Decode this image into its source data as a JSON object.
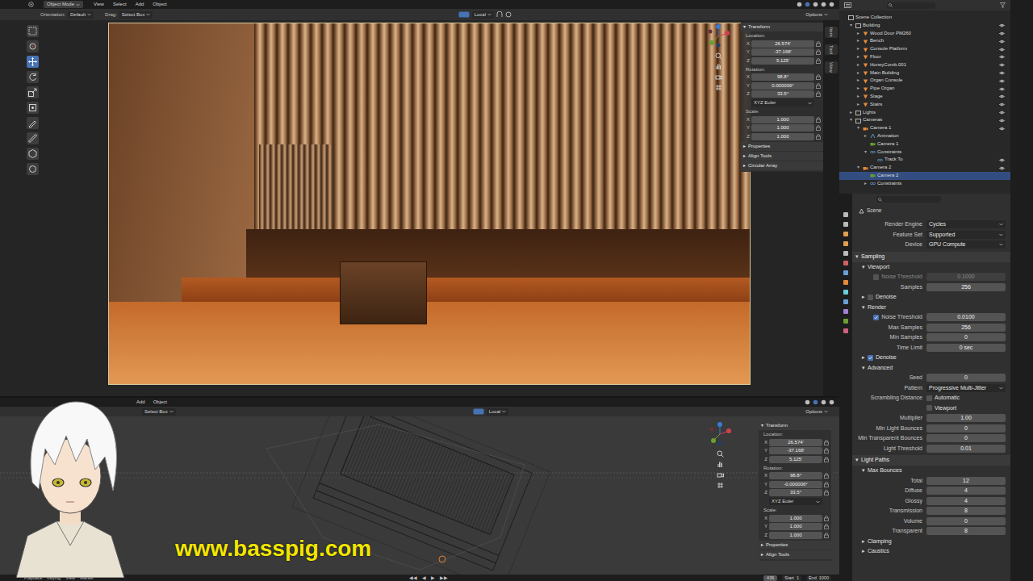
{
  "top_viewport": {
    "menu": [
      "Object Mode",
      "View",
      "Select",
      "Add",
      "Object"
    ],
    "header": [
      {
        "label": "Orientation:",
        "value": "Default"
      },
      {
        "label": "Drag:",
        "value": "Select Box"
      }
    ],
    "pivot": "Local",
    "options": "Options",
    "tools": [
      {
        "selected": false
      },
      {
        "selected": false
      },
      {
        "selected": true
      },
      {
        "selected": false
      },
      {
        "selected": false
      },
      {
        "selected": false
      },
      {
        "selected": false
      },
      {
        "selected": false
      },
      {
        "selected": false
      },
      {
        "selected": false
      }
    ],
    "side_tabs": [
      "Item",
      "Tool",
      "View"
    ],
    "transform": {
      "arrow": "▾",
      "title": "Transform",
      "groups": [
        {
          "label": "Location:",
          "fields": [
            {
              "axis": "X",
              "value": "26.574'"
            },
            {
              "axis": "Y",
              "value": "-37.168'"
            },
            {
              "axis": "Z",
              "value": "5.125'"
            }
          ]
        },
        {
          "label": "Rotation:",
          "fields": [
            {
              "axis": "X",
              "value": "98.8°"
            },
            {
              "axis": "Y",
              "value": "0.000006°"
            },
            {
              "axis": "Z",
              "value": "33.5°"
            }
          ],
          "mode": "XYZ Euler"
        },
        {
          "label": "Scale:",
          "fields": [
            {
              "axis": "X",
              "value": "1.000"
            },
            {
              "axis": "Y",
              "value": "1.000"
            },
            {
              "axis": "Z",
              "value": "1.000"
            }
          ]
        }
      ]
    },
    "panels": [
      {
        "arrow": "▸",
        "label": "Properties"
      },
      {
        "arrow": "▸",
        "label": "Align Tools"
      },
      {
        "arrow": "▸",
        "label": "Circular Array"
      }
    ]
  },
  "bottom_viewport": {
    "menu": [
      "Add",
      "Object"
    ],
    "drag": "Select Box",
    "pivot": "Local",
    "options": "Options",
    "transform": {
      "arrow": "▾",
      "title": "Transform",
      "groups": [
        {
          "label": "Location:",
          "fields": [
            {
              "axis": "X",
              "value": "26.574'"
            },
            {
              "axis": "Y",
              "value": "-37.168'"
            },
            {
              "axis": "Z",
              "value": "5.125'"
            }
          ]
        },
        {
          "label": "Rotation:",
          "fields": [
            {
              "axis": "X",
              "value": "98.8°"
            },
            {
              "axis": "Y",
              "value": "-0.000006°"
            },
            {
              "axis": "Z",
              "value": "33.5°"
            }
          ],
          "mode": "XYZ Euler"
        },
        {
          "label": "Scale:",
          "fields": [
            {
              "axis": "X",
              "value": "1.000"
            },
            {
              "axis": "Y",
              "value": "1.000"
            },
            {
              "axis": "Z",
              "value": "1.000"
            }
          ]
        }
      ]
    },
    "panels": [
      {
        "arrow": "▸",
        "label": "Properties"
      },
      {
        "arrow": "▸",
        "label": "Align Tools"
      }
    ]
  },
  "outliner": {
    "items": [
      {
        "label": "Scene Collection",
        "depth": 0,
        "arrow": "",
        "kind": "collection",
        "eye": false,
        "selected": false
      },
      {
        "label": "Building",
        "depth": 1,
        "arrow": "▾",
        "kind": "collection",
        "eye": true,
        "selected": false
      },
      {
        "label": "Wood Door PM260",
        "depth": 2,
        "arrow": "▸",
        "kind": "object",
        "eye": true,
        "selected": false
      },
      {
        "label": "Bench",
        "depth": 2,
        "arrow": "▸",
        "kind": "object",
        "eye": true,
        "selected": false
      },
      {
        "label": "Console Platform",
        "depth": 2,
        "arrow": "▸",
        "kind": "object",
        "eye": true,
        "selected": false
      },
      {
        "label": "Floor",
        "depth": 2,
        "arrow": "▸",
        "kind": "object",
        "eye": true,
        "selected": false
      },
      {
        "label": "HoneyComb.001",
        "depth": 2,
        "arrow": "▸",
        "kind": "object",
        "eye": true,
        "selected": false
      },
      {
        "label": "Main Building",
        "depth": 2,
        "arrow": "▸",
        "kind": "object",
        "eye": true,
        "selected": false
      },
      {
        "label": "Organ Console",
        "depth": 2,
        "arrow": "▸",
        "kind": "object",
        "eye": true,
        "selected": false
      },
      {
        "label": "Pipe Organ",
        "depth": 2,
        "arrow": "▸",
        "kind": "object",
        "eye": true,
        "selected": false
      },
      {
        "label": "Stage",
        "depth": 2,
        "arrow": "▸",
        "kind": "object",
        "eye": true,
        "selected": false
      },
      {
        "label": "Stairs",
        "depth": 2,
        "arrow": "▸",
        "kind": "object",
        "eye": true,
        "selected": false
      },
      {
        "label": "Lights",
        "depth": 1,
        "arrow": "▸",
        "kind": "collection",
        "eye": true,
        "selected": false
      },
      {
        "label": "Cameras",
        "depth": 1,
        "arrow": "▾",
        "kind": "collection",
        "eye": true,
        "selected": false
      },
      {
        "label": "Camera 1",
        "depth": 2,
        "arrow": "▾",
        "kind": "camera",
        "eye": true,
        "selected": false
      },
      {
        "label": "Animation",
        "depth": 3,
        "arrow": "▸",
        "kind": "animation",
        "eye": false,
        "selected": false
      },
      {
        "label": "Camera 1",
        "depth": 3,
        "arrow": "",
        "kind": "camera-data",
        "eye": false,
        "selected": false
      },
      {
        "label": "Constraints",
        "depth": 3,
        "arrow": "▾",
        "kind": "constraint",
        "eye": false,
        "selected": false
      },
      {
        "label": "Track To",
        "depth": 4,
        "arrow": "",
        "kind": "constraint",
        "eye": true,
        "selected": false
      },
      {
        "label": "Camera 2",
        "depth": 2,
        "arrow": "▾",
        "kind": "camera",
        "eye": true,
        "selected": false
      },
      {
        "label": "Camera 2",
        "depth": 3,
        "arrow": "",
        "kind": "camera-data",
        "eye": false,
        "selected": true
      },
      {
        "label": "Constraints",
        "depth": 3,
        "arrow": "▸",
        "kind": "constraint",
        "eye": false,
        "selected": false
      }
    ]
  },
  "properties": {
    "title": "Scene",
    "rows": [
      {
        "kind": "dropdown",
        "label": "Render Engine",
        "value": "Cycles"
      },
      {
        "kind": "dropdown",
        "label": "Feature Set",
        "value": "Supported"
      },
      {
        "kind": "dropdown",
        "label": "Device",
        "value": "GPU Compute"
      },
      {
        "kind": "section",
        "arrow": "▾",
        "label": "Sampling"
      },
      {
        "kind": "subsection",
        "arrow": "▾",
        "label": "Viewport",
        "checkbox": false,
        "checked": false
      },
      {
        "kind": "field",
        "label": "Noise Threshold",
        "value": "0.1000",
        "checkbox": true,
        "checked": false,
        "disabled": true
      },
      {
        "kind": "field",
        "label": "Samples",
        "value": "256",
        "checkbox": false,
        "checked": false,
        "disabled": false
      },
      {
        "kind": "subsection",
        "arrow": "▸",
        "label": "Denoise",
        "checkbox": true,
        "checked": false
      },
      {
        "kind": "subsection",
        "arrow": "▾",
        "label": "Render",
        "checkbox": false,
        "checked": false
      },
      {
        "kind": "field",
        "label": "Noise Threshold",
        "value": "0.0100",
        "checkbox": true,
        "checked": true,
        "disabled": false
      },
      {
        "kind": "field",
        "label": "Max Samples",
        "value": "256",
        "checkbox": false,
        "checked": false,
        "disabled": false
      },
      {
        "kind": "field",
        "label": "Min Samples",
        "value": "0",
        "checkbox": false,
        "checked": false,
        "disabled": false
      },
      {
        "kind": "field",
        "label": "Time Limit",
        "value": "0 sec",
        "checkbox": false,
        "checked": false,
        "disabled": false
      },
      {
        "kind": "subsection",
        "arrow": "▸",
        "label": "Denoise",
        "checkbox": true,
        "checked": true
      },
      {
        "kind": "subsection",
        "arrow": "▾",
        "label": "Advanced",
        "checkbox": false,
        "checked": false
      },
      {
        "kind": "field",
        "label": "Seed",
        "value": "0",
        "checkbox": false,
        "checked": false,
        "disabled": false
      },
      {
        "kind": "dropdown",
        "label": "Pattern",
        "value": "Progressive Multi-Jitter"
      },
      {
        "kind": "checkbox",
        "label": "Scrambling Distance",
        "text": "Automatic",
        "checked": false
      },
      {
        "kind": "checkbox",
        "text": "Viewport",
        "checked": false
      },
      {
        "kind": "field",
        "label": "Multiplier",
        "value": "1.00",
        "checkbox": false,
        "checked": false,
        "disabled": false
      },
      {
        "kind": "field",
        "label": "Min Light Bounces",
        "value": "0",
        "checkbox": false,
        "checked": false,
        "disabled": false
      },
      {
        "kind": "field",
        "label": "Min Transparent Bounces",
        "value": "0",
        "checkbox": false,
        "checked": false,
        "disabled": false
      },
      {
        "kind": "field",
        "label": "Light Threshold",
        "value": "0.01",
        "checkbox": false,
        "checked": false,
        "disabled": false
      },
      {
        "kind": "section",
        "arrow": "▾",
        "label": "Light Paths"
      },
      {
        "kind": "subsection",
        "arrow": "▾",
        "label": "Max Bounces",
        "checkbox": false,
        "checked": false
      },
      {
        "kind": "field",
        "label": "Total",
        "value": "12",
        "checkbox": false,
        "checked": false,
        "disabled": false
      },
      {
        "kind": "field",
        "label": "Diffuse",
        "value": "4",
        "checkbox": false,
        "checked": false,
        "disabled": false
      },
      {
        "kind": "field",
        "label": "Glossy",
        "value": "4",
        "checkbox": false,
        "checked": false,
        "disabled": false
      },
      {
        "kind": "field",
        "label": "Transmission",
        "value": "8",
        "checkbox": false,
        "checked": false,
        "disabled": false
      },
      {
        "kind": "field",
        "label": "Volume",
        "value": "0",
        "checkbox": false,
        "checked": false,
        "disabled": false
      },
      {
        "kind": "field",
        "label": "Transparent",
        "value": "8",
        "checkbox": false,
        "checked": false,
        "disabled": false
      },
      {
        "kind": "subsection",
        "arrow": "▸",
        "label": "Clamping",
        "checkbox": false,
        "checked": false
      },
      {
        "kind": "subsection",
        "arrow": "▸",
        "label": "Caustics",
        "checkbox": false,
        "checked": false
      }
    ]
  },
  "timeline": {
    "menu": [
      "Playback",
      "Keying",
      "View",
      "Marker"
    ],
    "controls": [
      "◀◀",
      "◀",
      "▶",
      "▶▶"
    ],
    "frame": "436",
    "start_label": "Start",
    "start": "1",
    "end_label": "End",
    "end": "1000"
  },
  "overlay": {
    "url": "www.basspig.com"
  }
}
